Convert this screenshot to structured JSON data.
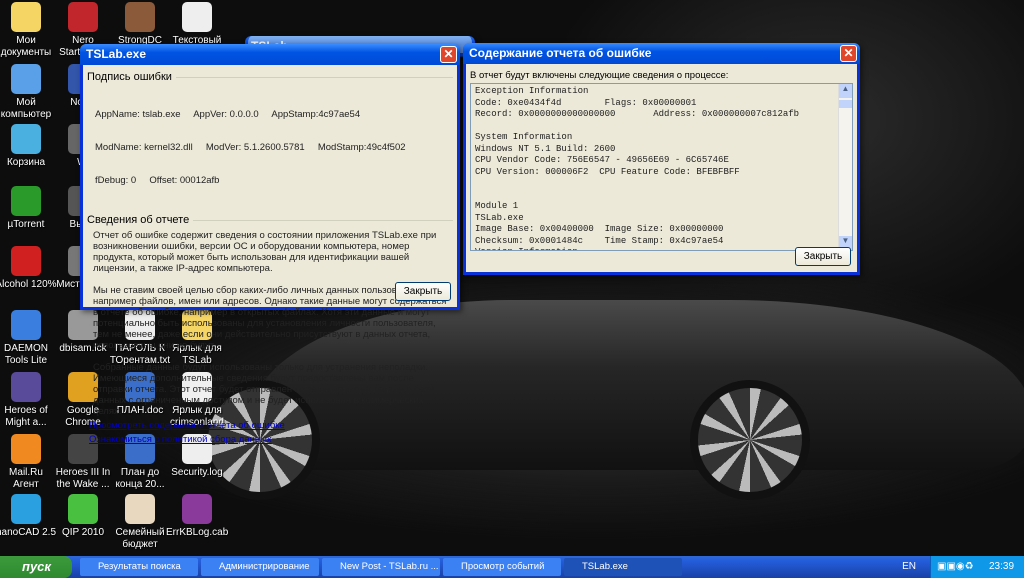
{
  "desktop_icons": [
    {
      "label": "Мои документы",
      "color": "#f5d563"
    },
    {
      "label": "Nero StartSmart",
      "color": "#c0262b"
    },
    {
      "label": "StrongDC",
      "color": "#8a5a3a"
    },
    {
      "label": "Текстовый документ",
      "color": "#eeeeee"
    },
    {
      "label": "Мой компьютер",
      "color": "#5aa0e8"
    },
    {
      "label": "Nokia",
      "color": "#3355aa"
    },
    {
      "label": "Корзина",
      "color": "#4ab0e0"
    },
    {
      "label": "Wi",
      "color": "#666666"
    },
    {
      "label": "µTorrent",
      "color": "#2a9a2a"
    },
    {
      "label": "Высш",
      "color": "#555555"
    },
    {
      "label": "Alcohol 120%",
      "color": "#d02020"
    },
    {
      "label": "Мисти хрон",
      "color": "#777777"
    },
    {
      "label": "DAEMON Tools Lite",
      "color": "#3a7ee0"
    },
    {
      "label": "dbisam.lck",
      "color": "#999999"
    },
    {
      "label": "ПАРОЛЬ К ТОрентам.txt",
      "color": "#eeeeee"
    },
    {
      "label": "Ярлык для TSLab",
      "color": "#f5d563"
    },
    {
      "label": "Heroes of Might a...",
      "color": "#5a4a9a"
    },
    {
      "label": "Google Chrome",
      "color": "#e0a020"
    },
    {
      "label": "ПЛАН.doc",
      "color": "#3a6ec8"
    },
    {
      "label": "Ярлык для crimsonland",
      "color": "#f0f0f0"
    },
    {
      "label": "Mail.Ru Агент",
      "color": "#f08a20"
    },
    {
      "label": "Heroes III In the Wake ...",
      "color": "#444444"
    },
    {
      "label": "План до конца 20...",
      "color": "#3a6ec8"
    },
    {
      "label": "Security.log",
      "color": "#eeeeee"
    },
    {
      "label": "nanoCAD 2.5",
      "color": "#2aa0e0"
    },
    {
      "label": "QIP 2010",
      "color": "#4ac040"
    },
    {
      "label": "Семейный бюджет",
      "color": "#e8d8c0"
    },
    {
      "label": "ErrKBLog.cab",
      "color": "#8a3a9a"
    }
  ],
  "bg_window": {
    "title": "TSLab"
  },
  "error_dialog": {
    "title": "TSLab.exe",
    "signature_group": "Подпись ошибки",
    "sig_lines": [
      "AppName: tslab.exe     AppVer: 0.0.0.0     AppStamp:4c97ae54",
      "ModName: kernel32.dll     ModVer: 5.1.2600.5781     ModStamp:49c4f502",
      "fDebug: 0     Offset: 00012afb"
    ],
    "report_group": "Сведения об отчете",
    "paragraphs": [
      "Отчет об ошибке содержит сведения о состоянии приложения TSLab.exe при возникновении ошибки, версии ОС и оборудовании компьютера, номер продукта, который может быть использован для идентификации вашей лицензии, а также IP-адрес компьютера.",
      "Мы не ставим своей целью сбор каких-либо личных данных пользователей, например файлов, имен или адресов. Однако такие данные могут содержаться в отчете об ошибке, например в открытых файлах. Хотя эти данные и могут потенциально быть использованы для установления личности пользователя, тем не менее, даже если они действительно присутствуют в данных отчета, использованы они не будут.",
      "Собранные данные будут использованы только для устранения неполадки. Имеющиеся дополнительные сведения будут предоставлены вам после отправки отчета. Этот отчет будет отправлен по защищенному каналу в базу данных с ограниченным доступом и не будет использован в коммерческих целях."
    ],
    "link_view": "Просмотреть содержимое отчета об ошибке",
    "link_policy": "Ознакомиться с политикой сбора данных",
    "close": "Закрыть"
  },
  "report_dialog": {
    "title": "Содержание отчета об ошибке",
    "intro": "В отчет будут включены следующие сведения о процессе:",
    "content": "Exception Information\nCode: 0xe0434f4d        Flags: 0x00000001\nRecord: 0x0000000000000000       Address: 0x000000007c812afb\n\nSystem Information\nWindows NT 5.1 Build: 2600\nCPU Vendor Code: 756E6547 - 49656E69 - 6C65746E\nCPU Version: 000006F2  CPU Feature Code: BFEBFBFF\n\n\nModule 1\nTSLab.exe\nImage Base: 0x00400000  Image Size: 0x00000000\nChecksum: 0x0001484c    Time Stamp: 0x4c97ae54\nVersion Information",
    "close": "Закрыть"
  },
  "taskbar": {
    "start": "пуск",
    "items": [
      "Результаты поиска",
      "Администрирование",
      "New Post - TSLab.ru ...",
      "Просмотр событий",
      "TSLab.exe"
    ],
    "lang": "EN",
    "clock": "23:39"
  }
}
